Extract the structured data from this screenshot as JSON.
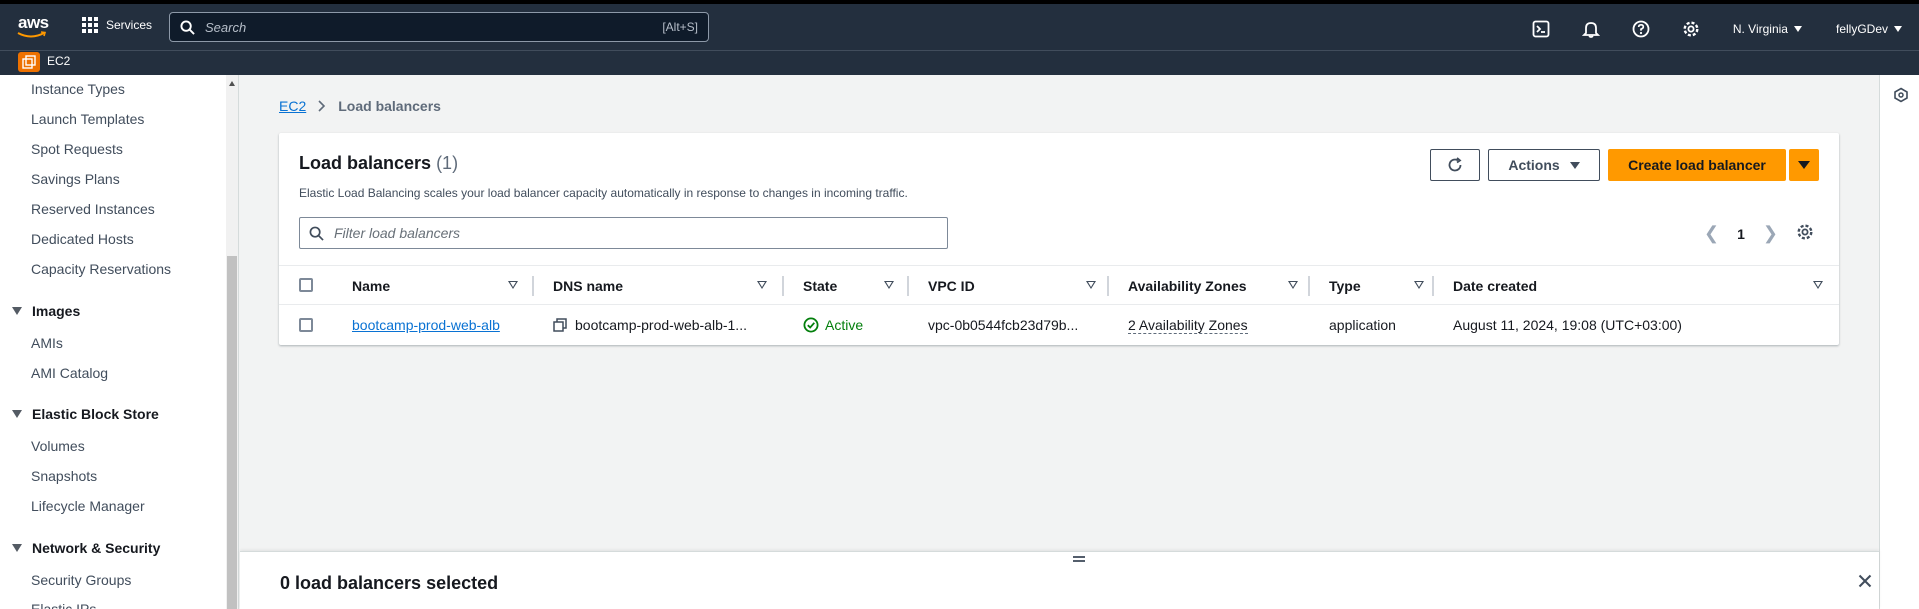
{
  "topnav": {
    "logo_text": "aws",
    "services_label": "Services",
    "search_placeholder": "Search",
    "search_shortcut": "[Alt+S]",
    "icons": [
      "cloudshell-icon",
      "bell-icon",
      "help-icon",
      "settings-icon"
    ],
    "region": "N. Virginia",
    "account": "fellyGDev"
  },
  "subnav": {
    "service": "EC2"
  },
  "sidebar": {
    "items_top": [
      "Instance Types",
      "Launch Templates",
      "Spot Requests",
      "Savings Plans",
      "Reserved Instances",
      "Dedicated Hosts",
      "Capacity Reservations"
    ],
    "images": {
      "title": "Images",
      "items": [
        "AMIs",
        "AMI Catalog"
      ]
    },
    "ebs": {
      "title": "Elastic Block Store",
      "items": [
        "Volumes",
        "Snapshots",
        "Lifecycle Manager"
      ]
    },
    "netsec": {
      "title": "Network & Security",
      "items": [
        "Security Groups",
        "Elastic IPs"
      ]
    }
  },
  "breadcrumb": {
    "root": "EC2",
    "current": "Load balancers"
  },
  "panel": {
    "title": "Load balancers",
    "count": "(1)",
    "description": "Elastic Load Balancing scales your load balancer capacity automatically in response to changes in incoming traffic.",
    "actions_label": "Actions",
    "create_label": "Create load balancer",
    "filter_placeholder": "Filter load balancers",
    "page": "1",
    "prev": "❮",
    "next": "❯"
  },
  "table": {
    "columns": [
      "Name",
      "DNS name",
      "State",
      "VPC ID",
      "Availability Zones",
      "Type",
      "Date created"
    ],
    "rows": [
      {
        "name": "bootcamp-prod-web-alb",
        "dns": "bootcamp-prod-web-alb-1...",
        "state": "Active",
        "vpc": "vpc-0b0544fcb23d79b...",
        "azs": "2 Availability Zones",
        "type": "application",
        "created": "August 11, 2024, 19:08 (UTC+03:00)"
      }
    ]
  },
  "split_panel": {
    "title": "0 load balancers selected"
  },
  "colors": {
    "nav_bg": "#232f3e",
    "accent_orange": "#ff9900",
    "link_blue": "#0972d3",
    "success_green": "#037f0c"
  }
}
